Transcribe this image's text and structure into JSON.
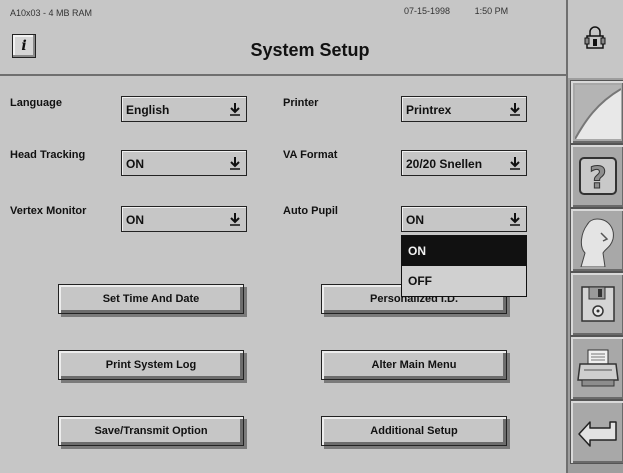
{
  "header": {
    "sysinfo": "A10x03 - 4 MB RAM",
    "date": "07-15-1998",
    "time": "1:50 PM",
    "info_label": "i",
    "title": "System Setup"
  },
  "fields": {
    "language": {
      "label": "Language",
      "value": "English"
    },
    "printer": {
      "label": "Printer",
      "value": "Printrex"
    },
    "head_tracking": {
      "label": "Head Tracking",
      "value": "ON"
    },
    "va_format": {
      "label": "VA Format",
      "value": "20/20 Snellen"
    },
    "vertex_monitor": {
      "label": "Vertex Monitor",
      "value": "ON"
    },
    "auto_pupil": {
      "label": "Auto Pupil",
      "value": "ON"
    }
  },
  "auto_pupil_dropdown": {
    "options": [
      "ON",
      "OFF"
    ],
    "highlighted": "ON"
  },
  "buttons": {
    "set_time_date": "Set Time And Date",
    "personalized_id": "Personalized I.D.",
    "print_system_log": "Print System Log",
    "alter_main_menu": "Alter Main Menu",
    "save_transmit": "Save/Transmit Option",
    "additional_setup": "Additional Setup"
  },
  "rail_icons": [
    "lock-icon",
    "chart-curve-icon",
    "help-question-icon",
    "patient-profile-icon",
    "floppy-disk-icon",
    "printer-icon",
    "return-arrow-icon"
  ],
  "colors": {
    "panel": "#c6c6c6",
    "highlight": "#111111",
    "rail": "#9e9e9e"
  }
}
